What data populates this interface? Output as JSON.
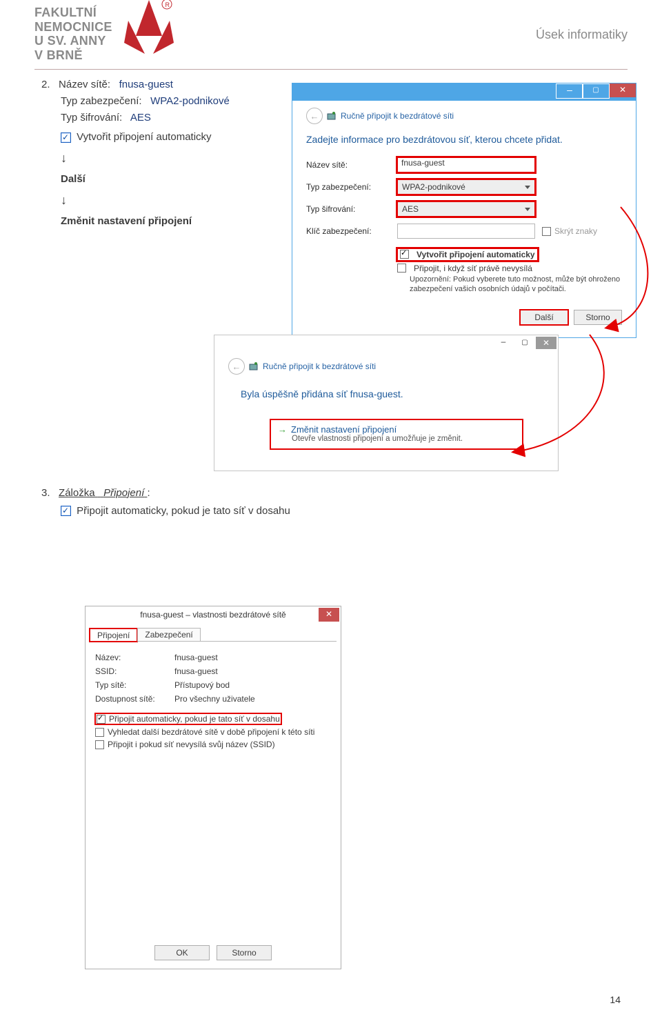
{
  "header": {
    "org_line1": "FAKULTNÍ",
    "org_line2": "NEMOCNICE",
    "org_line3": "U SV. ANNY",
    "org_line4": "V BRNĚ",
    "department": "Úsek informatiky"
  },
  "step2": {
    "prefix": "2.",
    "network_label": "Název sítě:",
    "network_value": "fnusa-guest",
    "security_label": "Typ zabezpečení:",
    "security_value": "WPA2-podnikové",
    "encryption_label": "Typ šifrování:",
    "encryption_value": "AES",
    "auto_connect": "Vytvořit připojení automaticky",
    "next": "Další",
    "change": "Změnit nastavení připojení"
  },
  "arrow": "↓",
  "wizard1": {
    "breadcrumb": "Ručně připojit k bezdrátové síti",
    "heading": "Zadejte informace pro bezdrátovou síť, kterou chcete přidat.",
    "labels": {
      "name": "Název sítě:",
      "security": "Typ zabezpečení:",
      "encryption": "Typ šifrování:",
      "key": "Klíč zabezpečení:",
      "hide": "Skrýt znaky",
      "chk_auto": "Vytvořit připojení automaticky",
      "chk_connect_hidden": "Připojit, i když síť právě nevysílá",
      "warn": "Upozornění: Pokud vyberete tuto možnost, může být ohroženo zabezpečení vašich osobních údajů v počítači."
    },
    "values": {
      "name": "fnusa-guest",
      "security": "WPA2-podnikové",
      "encryption": "AES",
      "key": ""
    },
    "buttons": {
      "next": "Další",
      "cancel": "Storno"
    }
  },
  "wizard2": {
    "breadcrumb": "Ručně připojit k bezdrátové síti",
    "heading": "Byla úspěšně přidána síť fnusa-guest.",
    "change_title": "Změnit nastavení připojení",
    "change_sub": "Otevře vlastnosti připojení a umožňuje je změnit."
  },
  "step3": {
    "prefix": "3.",
    "tab_label": "Záložka",
    "tab_name": "Připojení",
    "chk_label": "Připojit automaticky, pokud je tato síť v dosahu"
  },
  "props": {
    "title": "fnusa-guest – vlastnosti bezdrátové sítě",
    "tabs": {
      "connection": "Připojení",
      "security": "Zabezpečení"
    },
    "rows": {
      "name_k": "Název:",
      "name_v": "fnusa-guest",
      "ssid_k": "SSID:",
      "ssid_v": "fnusa-guest",
      "type_k": "Typ sítě:",
      "type_v": "Přístupový bod",
      "avail_k": "Dostupnost sítě:",
      "avail_v": "Pro všechny uživatele"
    },
    "checks": {
      "auto": "Připojit automaticky, pokud je tato síť v dosahu",
      "look": "Vyhledat další bezdrátové sítě v době připojení k této síti",
      "hidden": "Připojit i pokud síť nevysílá svůj název (SSID)"
    },
    "buttons": {
      "ok": "OK",
      "cancel": "Storno"
    }
  },
  "page_number": "14"
}
